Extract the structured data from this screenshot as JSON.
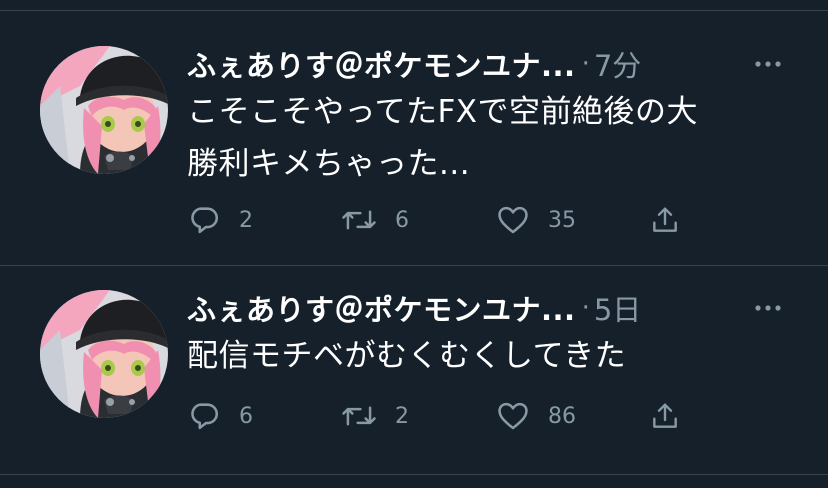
{
  "tweets": [
    {
      "display_name": "ふぇありす＠ポケモンユナ...",
      "separator": "·",
      "time": "7分",
      "text_lines": [
        "こそこそやってたFXで空前絶後の大",
        "勝利キメちゃった..."
      ],
      "replies": "2",
      "retweets": "6",
      "likes": "35"
    },
    {
      "display_name": "ふぇありす＠ポケモンユナ...",
      "separator": "·",
      "time": "5日",
      "text_lines": [
        "配信モチベがむくむくしてきた"
      ],
      "replies": "6",
      "retweets": "2",
      "likes": "86"
    }
  ],
  "icons": {
    "reply": "reply-icon",
    "retweet": "retweet-icon",
    "like": "heart-icon",
    "share": "share-icon",
    "more": "more-icon"
  },
  "colors": {
    "background": "#15202b",
    "text": "#ffffff",
    "secondary": "#8899a6",
    "divider": "#38444d"
  }
}
